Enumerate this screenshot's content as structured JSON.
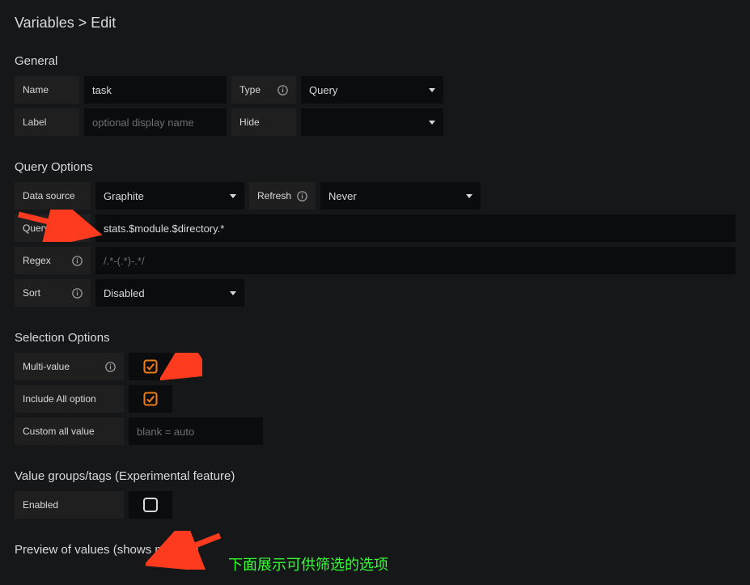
{
  "breadcrumb": "Variables > Edit",
  "sections": {
    "general": "General",
    "query_options": "Query Options",
    "selection_options": "Selection Options",
    "value_groups": "Value groups/tags (Experimental feature)",
    "preview": "Preview of values (shows max 20)"
  },
  "general": {
    "name_label": "Name",
    "name_value": "task",
    "type_label": "Type",
    "type_value": "Query",
    "label_label": "Label",
    "label_placeholder": "optional display name",
    "label_value": "",
    "hide_label": "Hide",
    "hide_value": ""
  },
  "query_options": {
    "datasource_label": "Data source",
    "datasource_value": "Graphite",
    "refresh_label": "Refresh",
    "refresh_value": "Never",
    "query_label": "Query",
    "query_value": "stats.$module.$directory.*",
    "regex_label": "Regex",
    "regex_placeholder": "/.*-(.*)-.*/",
    "regex_value": "",
    "sort_label": "Sort",
    "sort_value": "Disabled"
  },
  "selection_options": {
    "multivalue_label": "Multi-value",
    "multivalue_checked": true,
    "includeall_label": "Include All option",
    "includeall_checked": true,
    "customall_label": "Custom all value",
    "customall_placeholder": "blank = auto",
    "customall_value": ""
  },
  "value_groups": {
    "enabled_label": "Enabled",
    "enabled_checked": false
  },
  "annotation": {
    "preview_note": "下面展示可供筛选的选项"
  },
  "colors": {
    "accent": "#eb7b18",
    "annotation_arrow": "#ff3b1f",
    "annotation_text": "#33ff33"
  }
}
